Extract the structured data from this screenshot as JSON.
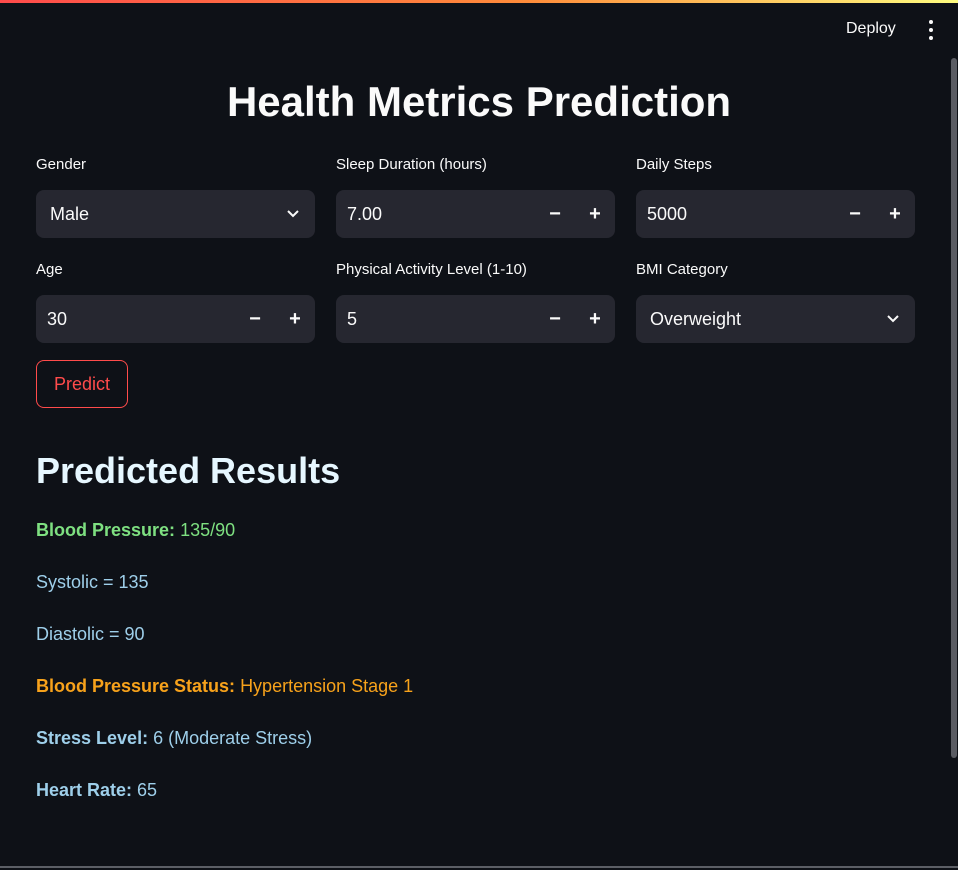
{
  "toolbar": {
    "deploy_label": "Deploy",
    "menu_icon": "vertical-dots-icon"
  },
  "title": "Health Metrics Prediction",
  "inputs": {
    "gender": {
      "label": "Gender",
      "value": "Male"
    },
    "sleep": {
      "label": "Sleep Duration (hours)",
      "value": "7.00"
    },
    "steps": {
      "label": "Daily Steps",
      "value": "5000"
    },
    "age": {
      "label": "Age",
      "value": "30"
    },
    "activity": {
      "label": "Physical Activity Level (1-10)",
      "value": "5"
    },
    "bmi": {
      "label": "BMI Category",
      "value": "Overweight"
    },
    "decrement": "−",
    "increment": "+"
  },
  "predict_label": "Predict",
  "results": {
    "heading": "Predicted Results",
    "bp_label": "Blood Pressure:",
    "bp_value": "135/90",
    "systolic": "Systolic = 135",
    "diastolic": "Diastolic = 90",
    "bp_status_label": "Blood Pressure Status:",
    "bp_status_value": "Hypertension Stage 1",
    "stress_label": "Stress Level:",
    "stress_value": "6 (Moderate Stress)",
    "hr_label": "Heart Rate:",
    "hr_value": "65"
  },
  "colors": {
    "background": "#0e1117",
    "input_bg": "#262730",
    "accent": "#ff4b4b",
    "green": "#7ee081",
    "blue": "#9ecfea",
    "orange": "#f7a21b"
  }
}
